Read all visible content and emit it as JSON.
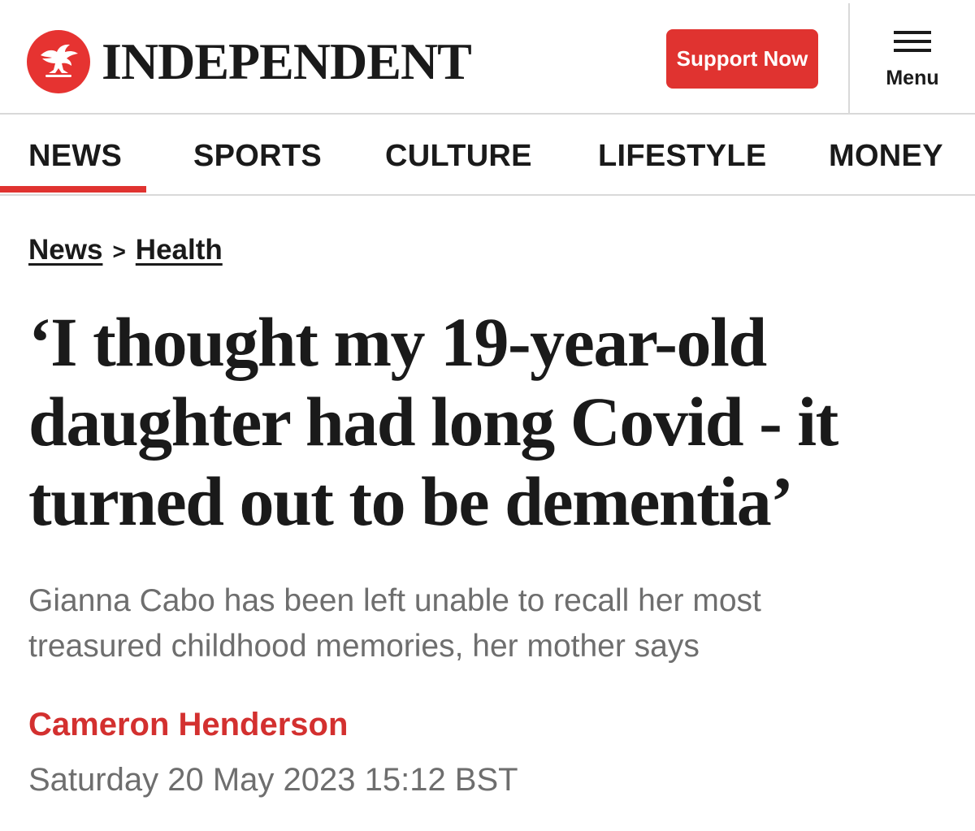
{
  "header": {
    "brand_name": "INDEPENDENT",
    "logo_icon": "eagle-icon",
    "support_label": "Support Now",
    "menu_label": "Menu",
    "brand_color": "#e03330"
  },
  "nav": {
    "items": [
      {
        "label": "NEWS",
        "active": true
      },
      {
        "label": "SPORTS",
        "active": false
      },
      {
        "label": "CULTURE",
        "active": false
      },
      {
        "label": "LIFESTYLE",
        "active": false
      },
      {
        "label": "MONEY",
        "active": false
      }
    ]
  },
  "breadcrumb": {
    "items": [
      "News",
      "Health"
    ],
    "separator": ">"
  },
  "article": {
    "headline_lines": [
      "‘I thought my 19-year-old",
      "daughter had long Covid - it",
      "turned out to be dementia’"
    ],
    "standfirst_lines": [
      "Gianna Cabo has been left unable to recall her most",
      "treasured childhood memories, her mother says"
    ],
    "author": "Cameron Henderson",
    "date": "Saturday 20 May 2023 15:12 BST"
  }
}
